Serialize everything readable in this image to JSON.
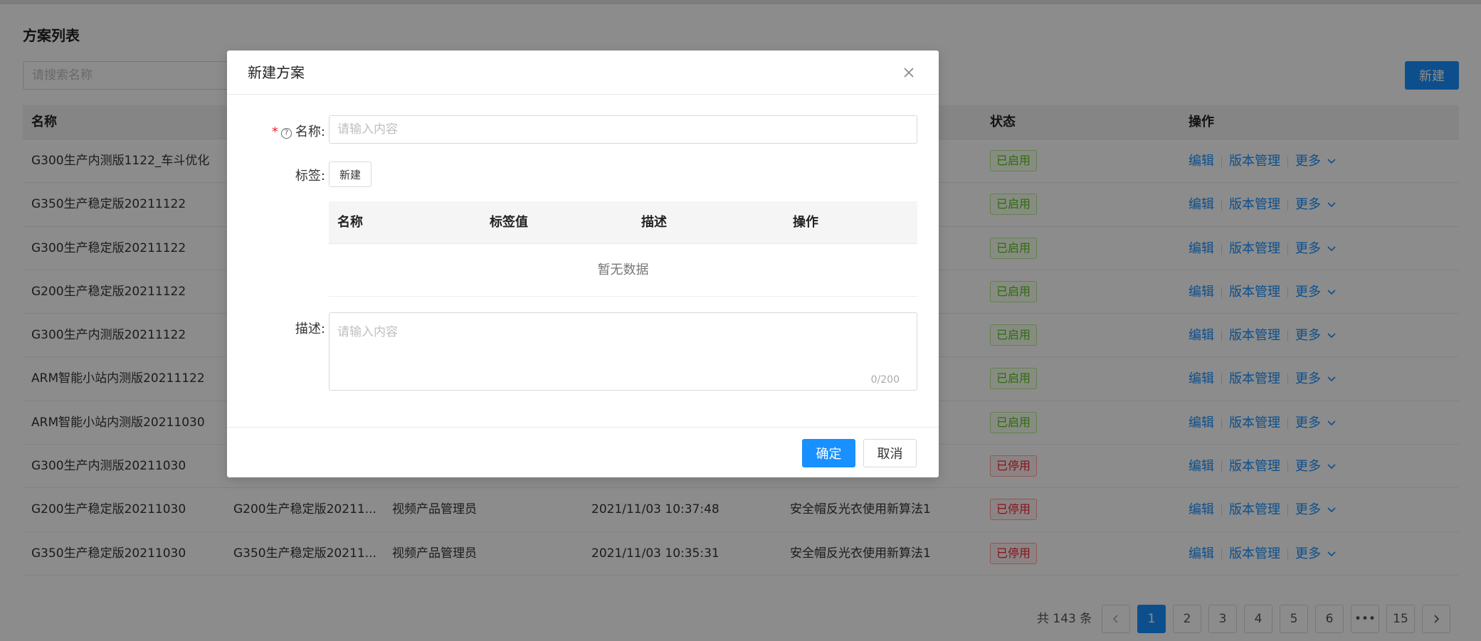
{
  "page": {
    "title": "方案列表",
    "search_placeholder": "请搜索名称",
    "new_button": "新建"
  },
  "table": {
    "columns": {
      "name": "名称",
      "status": "状态",
      "actions": "操作"
    },
    "rows": [
      {
        "name": "G300生产内测版1122_车斗优化",
        "col2": "",
        "col3": "",
        "time": "",
        "algo": "",
        "status": "已启用",
        "status_type": "on"
      },
      {
        "name": "G350生产稳定版20211122",
        "col2": "",
        "col3": "",
        "time": "",
        "algo": "",
        "status": "已启用",
        "status_type": "on"
      },
      {
        "name": "G300生产稳定版20211122",
        "col2": "",
        "col3": "",
        "time": "",
        "algo": "",
        "status": "已启用",
        "status_type": "on"
      },
      {
        "name": "G200生产稳定版20211122",
        "col2": "",
        "col3": "",
        "time": "",
        "algo": "",
        "status": "已启用",
        "status_type": "on"
      },
      {
        "name": "G300生产内测版20211122",
        "col2": "",
        "col3": "",
        "time": "",
        "algo": "",
        "status": "已启用",
        "status_type": "on"
      },
      {
        "name": "ARM智能小站内测版20211122",
        "col2": "",
        "col3": "",
        "time": "",
        "algo": "",
        "status": "已启用",
        "status_type": "on"
      },
      {
        "name": "ARM智能小站内测版20211030",
        "col2": "",
        "col3": "",
        "time": "",
        "algo": "",
        "status": "已启用",
        "status_type": "on"
      },
      {
        "name": "G300生产内测版20211030",
        "col2": "",
        "col3": "",
        "time": "",
        "algo": "",
        "status": "已停用",
        "status_type": "off"
      },
      {
        "name": "G200生产稳定版20211030",
        "col2": "G200生产稳定版20211...",
        "col3": "视频产品管理员",
        "time": "2021/11/03 10:37:48",
        "algo": "安全帽反光衣使用新算法1",
        "status": "已停用",
        "status_type": "off"
      },
      {
        "name": "G350生产稳定版20211030",
        "col2": "G350生产稳定版20211...",
        "col3": "视频产品管理员",
        "time": "2021/11/03 10:35:31",
        "algo": "安全帽反光衣使用新算法1",
        "status": "已停用",
        "status_type": "off"
      }
    ],
    "row_actions": {
      "edit": "编辑",
      "version": "版本管理",
      "more": "更多"
    }
  },
  "pagination": {
    "total": "共 143 条",
    "pages": [
      "1",
      "2",
      "3",
      "4",
      "5",
      "6",
      "•••",
      "15"
    ],
    "current": "1"
  },
  "modal": {
    "title": "新建方案",
    "name_label": "名称:",
    "name_placeholder": "请输入内容",
    "tags_label": "标签:",
    "tags_new_button": "新建",
    "tags_table": {
      "columns": [
        "名称",
        "标签值",
        "描述",
        "操作"
      ],
      "empty_text": "暂无数据"
    },
    "desc_label": "描述:",
    "desc_placeholder": "请输入内容",
    "desc_counter": "0/200",
    "ok_button": "确定",
    "cancel_button": "取消"
  },
  "colors": {
    "primary": "#1890ff",
    "enabled": "#52c41a",
    "disabled": "#f5222d"
  }
}
